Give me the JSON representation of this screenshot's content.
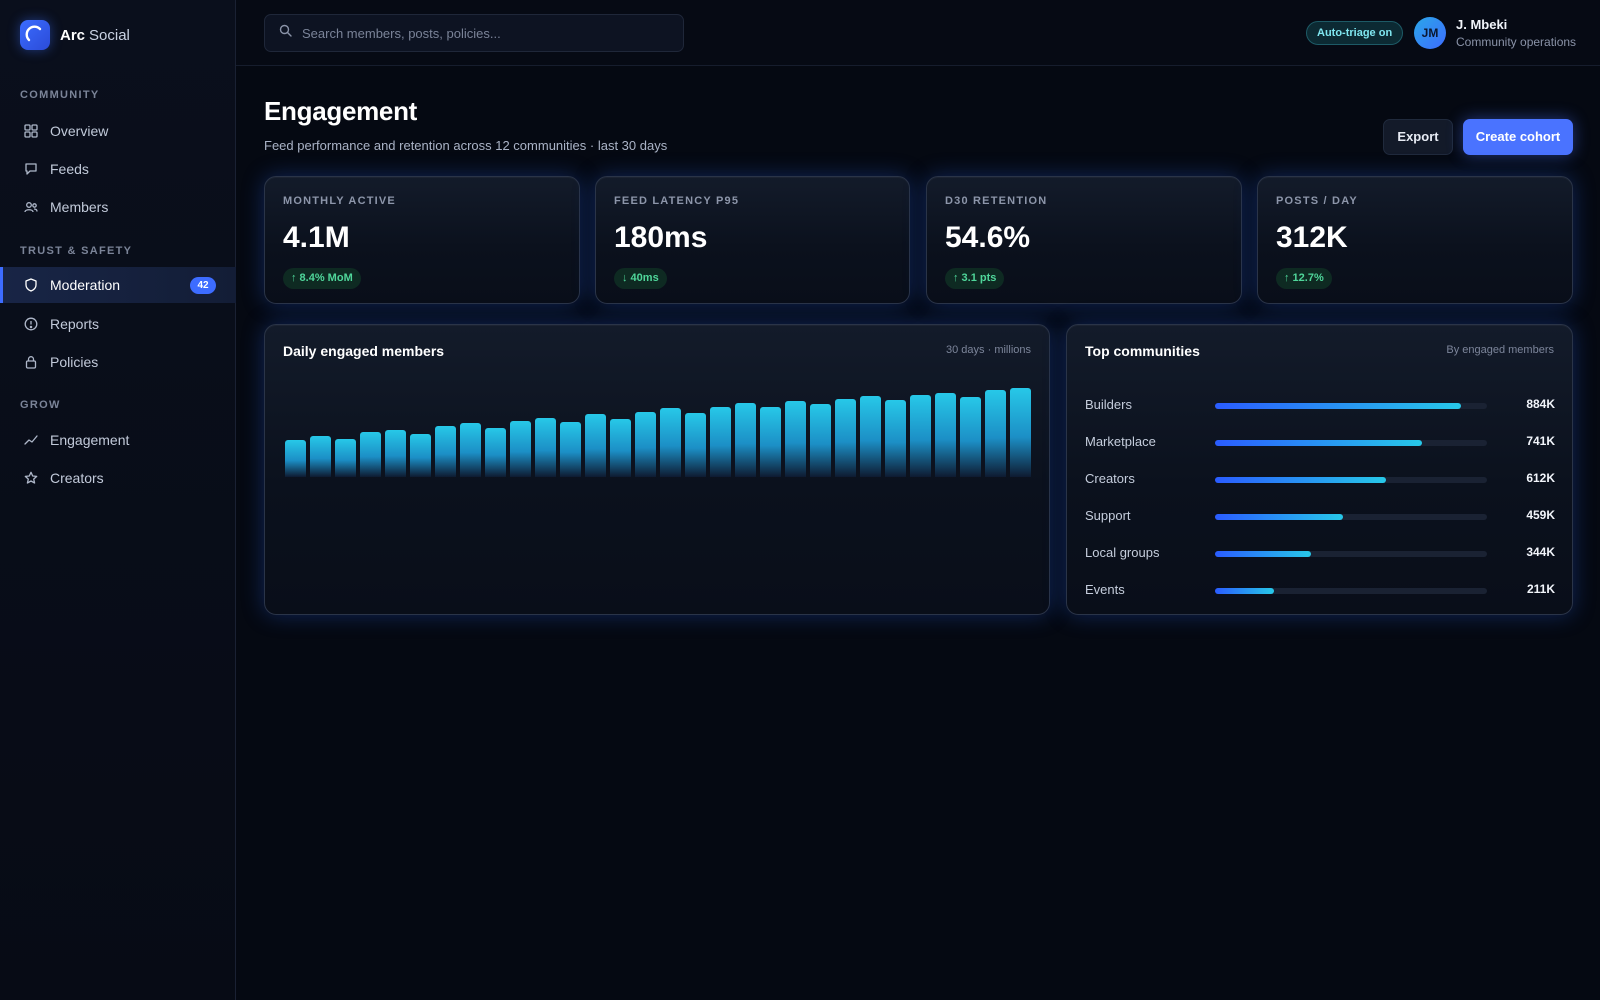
{
  "brand": {
    "name": "Arc",
    "name_suffix": "Social"
  },
  "sidebar": {
    "sections": [
      {
        "label": "COMMUNITY"
      },
      {
        "label": "TRUST & SAFETY"
      },
      {
        "label": "GROW"
      }
    ],
    "items": [
      {
        "label": "Overview",
        "icon": "grid-icon"
      },
      {
        "label": "Feeds",
        "icon": "chat-icon"
      },
      {
        "label": "Members",
        "icon": "users-icon"
      },
      {
        "label": "Moderation",
        "icon": "shield-icon",
        "badge": "42",
        "active": true
      },
      {
        "label": "Reports",
        "icon": "alert-circle-icon"
      },
      {
        "label": "Policies",
        "icon": "lock-icon"
      },
      {
        "label": "Engagement",
        "icon": "trend-line-icon"
      },
      {
        "label": "Creators",
        "icon": "star-icon"
      }
    ]
  },
  "topbar": {
    "search_placeholder": "Search members, posts, policies...",
    "auto_triage": "Auto-triage on",
    "user": {
      "initials": "JM",
      "name": "J. Mbeki",
      "role": "Community operations"
    }
  },
  "header": {
    "title": "Engagement",
    "subtitle": "Feed performance and retention across 12 communities · last 30 days",
    "export_label": "Export",
    "create_label": "Create cohort"
  },
  "kpis": [
    {
      "label": "MONTHLY ACTIVE",
      "value": "4.1M",
      "delta": "↑ 8.4% MoM"
    },
    {
      "label": "FEED LATENCY P95",
      "value": "180ms",
      "delta": "↓ 40ms"
    },
    {
      "label": "D30 RETENTION",
      "value": "54.6%",
      "delta": "↑ 3.1 pts"
    },
    {
      "label": "POSTS / DAY",
      "value": "312K",
      "delta": "↑ 12.7%"
    }
  ],
  "daily_chart": {
    "title": "Daily engaged members",
    "meta": "30 days · millions"
  },
  "communities": {
    "title": "Top communities",
    "meta": "By engaged members",
    "rows": [
      {
        "name": "Builders",
        "value": "884K"
      },
      {
        "name": "Marketplace",
        "value": "741K"
      },
      {
        "name": "Creators",
        "value": "612K"
      },
      {
        "name": "Support",
        "value": "459K"
      },
      {
        "name": "Local groups",
        "value": "344K"
      },
      {
        "name": "Events",
        "value": "211K"
      }
    ]
  },
  "chart_data": [
    {
      "type": "bar",
      "title": "Daily engaged members",
      "xlabel": "",
      "ylabel": "",
      "ylim": [
        0,
        3.2
      ],
      "values": [
        1.35,
        1.5,
        1.4,
        1.62,
        1.72,
        1.55,
        1.85,
        1.95,
        1.8,
        2.05,
        2.15,
        2.0,
        2.28,
        2.12,
        2.36,
        2.5,
        2.32,
        2.55,
        2.7,
        2.55,
        2.75,
        2.64,
        2.85,
        2.95,
        2.8,
        3.0,
        3.05,
        2.9,
        3.15,
        3.22
      ]
    },
    {
      "type": "bar",
      "title": "Top communities",
      "categories": [
        "Builders",
        "Marketplace",
        "Creators",
        "Support",
        "Local groups",
        "Events"
      ],
      "values": [
        884,
        741,
        612,
        459,
        344,
        211
      ],
      "xlim": [
        0,
        976
      ]
    }
  ]
}
